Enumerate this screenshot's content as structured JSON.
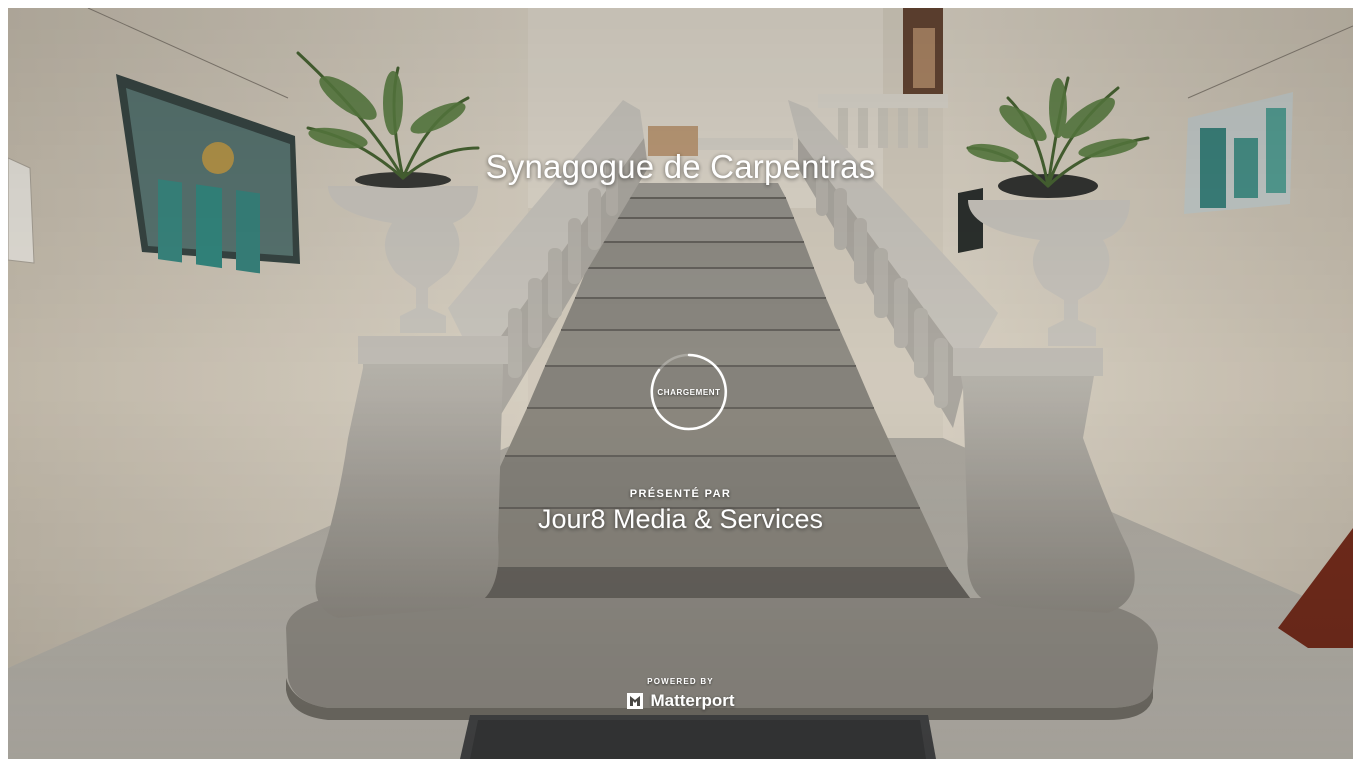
{
  "viewer": {
    "title": "Synagogue de Carpentras",
    "loading_label": "CHARGEMENT",
    "presented_by_label": "PRÉSENTÉ PAR",
    "presenter_name": "Jour8 Media & Services",
    "powered_by_label": "POWERED BY",
    "brand_name": "Matterport",
    "brand_icon": "matterport-logo-icon"
  },
  "colors": {
    "overlay_text": "#ffffff",
    "wall": "#e6ddcd",
    "stone": "#9b978f",
    "floor": "#a8a59e"
  }
}
